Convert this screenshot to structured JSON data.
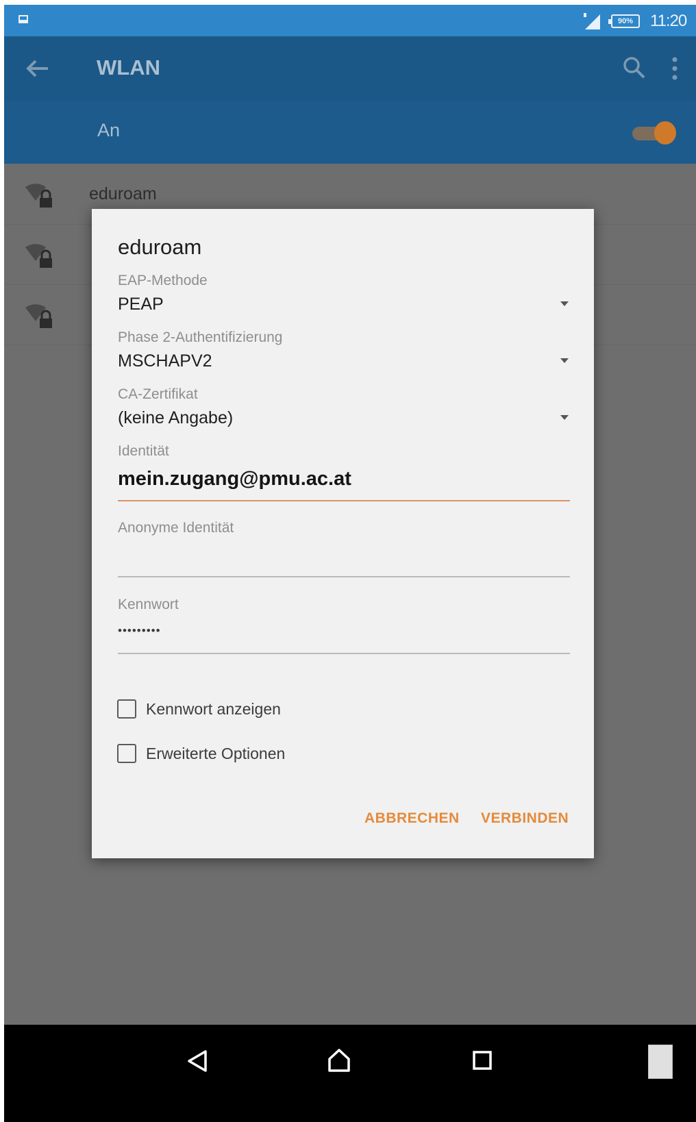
{
  "status_bar": {
    "battery": "90%",
    "time": "11:20",
    "icons": [
      "notification-icon",
      "signal-icon",
      "battery-icon"
    ]
  },
  "app_bar": {
    "title": "WLAN",
    "icons": [
      "back-arrow-icon",
      "search-icon",
      "more-vert-icon"
    ]
  },
  "wifi_switch": {
    "label": "An",
    "on": true
  },
  "networks": [
    {
      "name": "eduroam",
      "icon": "wifi-lock-icon"
    },
    {
      "name": "",
      "icon": "wifi-lock-icon"
    },
    {
      "name": "",
      "icon": "wifi-lock-icon"
    }
  ],
  "dialog": {
    "title": "eduroam",
    "eap_method": {
      "label": "EAP-Methode",
      "value": "PEAP"
    },
    "phase2": {
      "label": "Phase 2-Authentifizierung",
      "value": "MSCHAPV2"
    },
    "ca_cert": {
      "label": "CA-Zertifikat",
      "value": "(keine Angabe)"
    },
    "identity": {
      "label": "Identität",
      "value": "mein.zugang@pmu.ac.at"
    },
    "anon_identity": {
      "label": "Anonyme Identität",
      "value": ""
    },
    "password": {
      "label": "Kennwort",
      "value": "•••••••••"
    },
    "show_password": {
      "label": "Kennwort anzeigen",
      "checked": false
    },
    "advanced_options": {
      "label": "Erweiterte Optionen",
      "checked": false
    },
    "cancel_label": "ABBRECHEN",
    "connect_label": "VERBINDEN"
  },
  "nav_bar": {
    "icons": [
      "back-icon",
      "home-icon",
      "recents-icon"
    ]
  },
  "colors": {
    "status_bar": "#2f86c8",
    "app_bar": "#1c5887",
    "accent": "#e58a3b",
    "dialog_bg": "#f1f1f1",
    "scrim": "#6e6e6e"
  }
}
